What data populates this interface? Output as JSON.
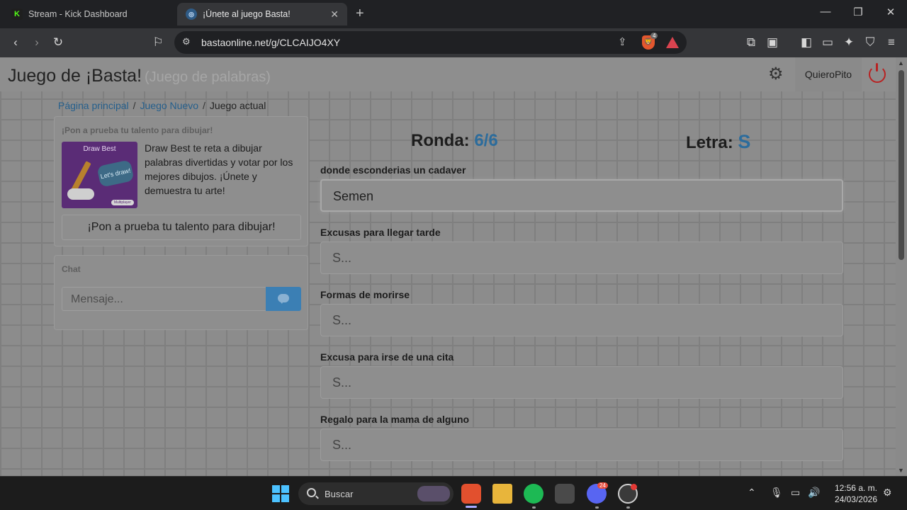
{
  "browser": {
    "tabs": [
      {
        "title": "Stream - Kick Dashboard",
        "favicon": "kick-icon"
      },
      {
        "title": "¡Únete al juego Basta!",
        "favicon": "basta-icon"
      }
    ],
    "url": "bastaonline.net/g/CLCAIJO4XY",
    "shield_count": "4"
  },
  "site": {
    "title": "Juego de ¡Basta!",
    "subtitle": "(Juego de palabras)",
    "username": "QuieroPito"
  },
  "breadcrumb": {
    "home": "Página principal",
    "new_game": "Juego Nuevo",
    "current": "Juego actual"
  },
  "promo": {
    "heading": "¡Pon a prueba tu talento para dibujar!",
    "image_title": "Draw Best",
    "image_badge": "Let's draw!",
    "image_mini": "Multiplayer",
    "text": "Draw Best te reta a dibujar palabras divertidas y votar por los mejores dibujos. ¡Únete y demuestra tu arte!",
    "button": "¡Pon a prueba tu talento para dibujar!"
  },
  "chat": {
    "heading": "Chat",
    "placeholder": "Mensaje..."
  },
  "game": {
    "round_label": "Ronda:",
    "round_value": "6/6",
    "letter_label": "Letra:",
    "letter_value": "S",
    "categories": [
      {
        "label": "donde esconderias un cadaver",
        "value": "Semen",
        "placeholder": "S..."
      },
      {
        "label": "Excusas para llegar tarde",
        "value": "",
        "placeholder": "S..."
      },
      {
        "label": "Formas de morirse",
        "value": "",
        "placeholder": "S..."
      },
      {
        "label": "Excusa para irse de una cita",
        "value": "",
        "placeholder": "S..."
      },
      {
        "label": "Regalo para la mama de alguno",
        "value": "",
        "placeholder": "S..."
      }
    ]
  },
  "taskbar": {
    "search_placeholder": "Buscar",
    "discord_badge": "24",
    "time": "12:56 a. m.",
    "date": "24/03/2026"
  },
  "colors": {
    "accent_blue": "#2c6c9c",
    "power_red": "#b82222",
    "send_button": "#3b7fb4"
  }
}
